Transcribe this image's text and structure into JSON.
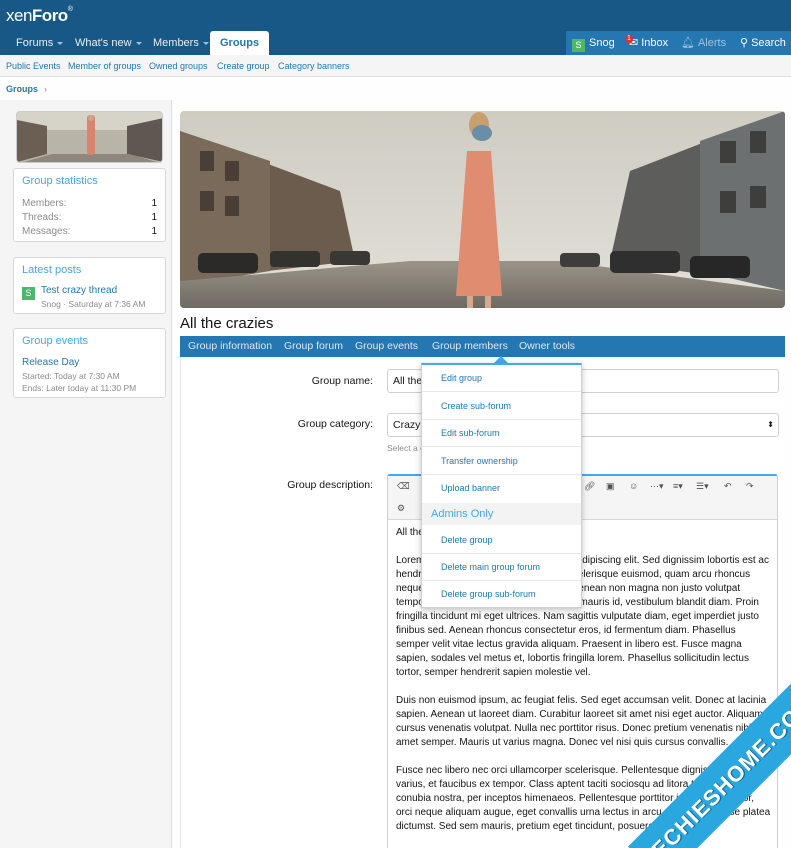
{
  "header": {
    "logo_light": "xen",
    "logo_bold": "Foro",
    "logo_mark": "®",
    "nav": [
      {
        "label": "Forums",
        "has_caret": true
      },
      {
        "label": "What's new",
        "has_caret": true
      },
      {
        "label": "Members",
        "has_caret": true
      },
      {
        "label": "Groups",
        "selected": true
      }
    ],
    "account": {
      "avatar_letter": "S",
      "name": "Snog"
    },
    "inbox": {
      "label": "Inbox",
      "badge": "1"
    },
    "alerts": {
      "label": "Alerts"
    },
    "search": {
      "label": "Search"
    },
    "colors": {
      "header": "#185886",
      "accent": "#2577b1",
      "light_accent": "#47a7eb"
    }
  },
  "subnav": [
    "Public Events",
    "Member of groups",
    "Owned groups",
    "Create group",
    "Category banners"
  ],
  "breadcrumb": {
    "label": "Groups",
    "sep": "›"
  },
  "sidebar": {
    "stats": {
      "title": "Group statistics",
      "rows": [
        {
          "label": "Members:",
          "value": "1"
        },
        {
          "label": "Threads:",
          "value": "1"
        },
        {
          "label": "Messages:",
          "value": "1"
        }
      ]
    },
    "latest": {
      "title": "Latest posts",
      "avatar_letter": "S",
      "thread": "Test crazy thread",
      "meta": "Snog · Saturday at 7:36 AM"
    },
    "events": {
      "title": "Group events",
      "name": "Release Day",
      "started": "Started: Today at 7:30 AM",
      "ends": "Ends: Later today at 11:30 PM"
    }
  },
  "group": {
    "title": "All the crazies",
    "tabs": [
      "Group information",
      "Group forum",
      "Group events",
      "Group members",
      "Owner tools"
    ]
  },
  "form": {
    "name_label": "Group name:",
    "name_value": "All the crazies",
    "category_label": "Group category:",
    "category_value": "Crazy",
    "category_hint": "Select a category",
    "desc_label": "Group description:",
    "editor_first_line": "All the crazies",
    "paragraphs": [
      "Lorem ipsum dolor sit amet, consectetur adipiscing elit. Sed dignissim lobortis est ac hendrerit. Pellentesque habitant morbi scelerisque euismod, quam arcu rhoncus neque, nec faucibus massa nibh a orci. Aenean non magna non justo volutpat tempor sed a nunc. Nullam a magna non mauris id, vestibulum blandit diam. Proin fringilla tincidunt mi eget ultrices. Nam sagittis vulputate diam, eget imperdiet justo finibus sed. Aenean rhoncus consectetur eros, id fermentum diam. Phasellus semper velit vitae lectus gravida aliquam. Praesent in libero est. Fusce magna sapien, sodales vel metus et, lobortis fringilla lorem. Phasellus sollicitudin lectus tortor, semper hendrerit sapien molestie vel.",
      "Duis non euismod ipsum, ac feugiat felis. Sed eget accumsan velit. Donec at lacinia sapien. Aenean ut laoreet diam. Curabitur laoreet sit amet nisi eget auctor. Aliquam cursus venenatis volutpat. Nulla nec porttitor risus. Donec pretium venenatis nibh sit amet semper. Mauris ut varius magna. Donec vel nisi quis cursus convallis.",
      "Fusce nec libero nec orci ullamcorper scelerisque. Pellentesque dignissim id ex varius, et faucibus ex tempor. Class aptent taciti sociosqu ad litora torquent per conubia nostra, per inceptos himenaeos. Pellentesque porttitor in lacinia porttitor, orci neque aliquam augue, eget convallis urna lectus in arcu. In hac habitasse platea dictumst. Sed sem mauris, pretium eget tincidunt, posuere"
    ]
  },
  "owner_menu": {
    "items": [
      "Edit group",
      "Create sub-forum",
      "Edit sub-forum",
      "Transfer ownership",
      "Upload banner"
    ],
    "admin_header": "Admins Only",
    "admin_items": [
      "Delete group",
      "Delete main group forum",
      "Delete group sub-forum"
    ]
  },
  "watermark": "TECHIESHOME.COM"
}
